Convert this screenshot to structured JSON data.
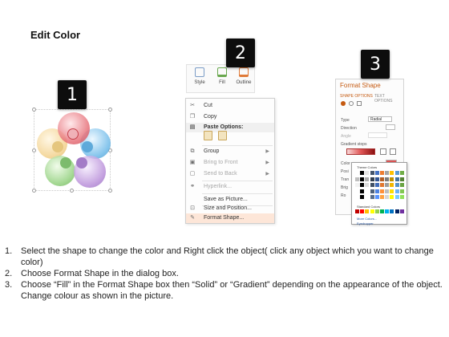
{
  "title": "Edit Color",
  "steps": [
    {
      "number": "1"
    },
    {
      "number": "2"
    },
    {
      "number": "3"
    }
  ],
  "ribbon": {
    "style_label": "Style",
    "fill_label": "Fill",
    "outline_label": "Outline"
  },
  "context_menu": {
    "items": [
      {
        "label": "Cut",
        "icon": "scissors-icon",
        "state": "normal"
      },
      {
        "label": "Copy",
        "icon": "copy-icon",
        "state": "normal"
      },
      {
        "label": "Paste Options:",
        "icon": "clipboard-icon",
        "state": "header"
      },
      {
        "label": "Group",
        "icon": "group-icon",
        "state": "normal"
      },
      {
        "label": "Bring to Front",
        "icon": "bring-front-icon",
        "state": "disabled"
      },
      {
        "label": "Send to Back",
        "icon": "send-back-icon",
        "state": "disabled"
      },
      {
        "label": "Hyperlink...",
        "icon": "hyperlink-icon",
        "state": "disabled"
      },
      {
        "label": "Save as Picture...",
        "icon": "none",
        "state": "normal"
      },
      {
        "label": "Size and Position...",
        "icon": "size-icon",
        "state": "normal"
      },
      {
        "label": "Format Shape...",
        "icon": "format-shape-icon",
        "state": "highlighted"
      }
    ]
  },
  "format_pane": {
    "title": "Format Shape",
    "tab_shape_options": "SHAPE OPTIONS",
    "tab_text_options": "TEXT OPTIONS",
    "type_label": "Type",
    "type_value": "Radial",
    "direction_label": "Direction",
    "angle_label": "Angle",
    "gradient_stops_label": "Gradient stops",
    "color_label": "Color",
    "position_label": "Posi",
    "transparency_label": "Tran",
    "brightness_label": "Brig",
    "rotate_label": "Ro"
  },
  "palette": {
    "theme_colors_label": "Theme Colors",
    "standard_colors_label": "Standard Colors",
    "more_colors_label": "More Colors...",
    "eyedropper_label": "Eyedropper"
  },
  "colors": {
    "ball_red": "#e56a73",
    "ball_blue": "#6ab8e8",
    "ball_yellow": "#f2d08a",
    "ball_green": "#8fcf7a",
    "ball_purple": "#b78cd8",
    "menu_highlight": "#fde6d8",
    "accent_orange": "#c55a11"
  },
  "instructions": [
    {
      "number": "1.",
      "text": "Select the shape to change the color and Right click the object( click any object which you want to change color)"
    },
    {
      "number": "2.",
      "text": "Choose Format Shape in the dialog box."
    },
    {
      "number": "3.",
      "text": "Choose “Fill” in the Format Shape box then “Solid” or “Gradient” depending on the appearance of the object. Change colour as shown in the picture."
    }
  ]
}
